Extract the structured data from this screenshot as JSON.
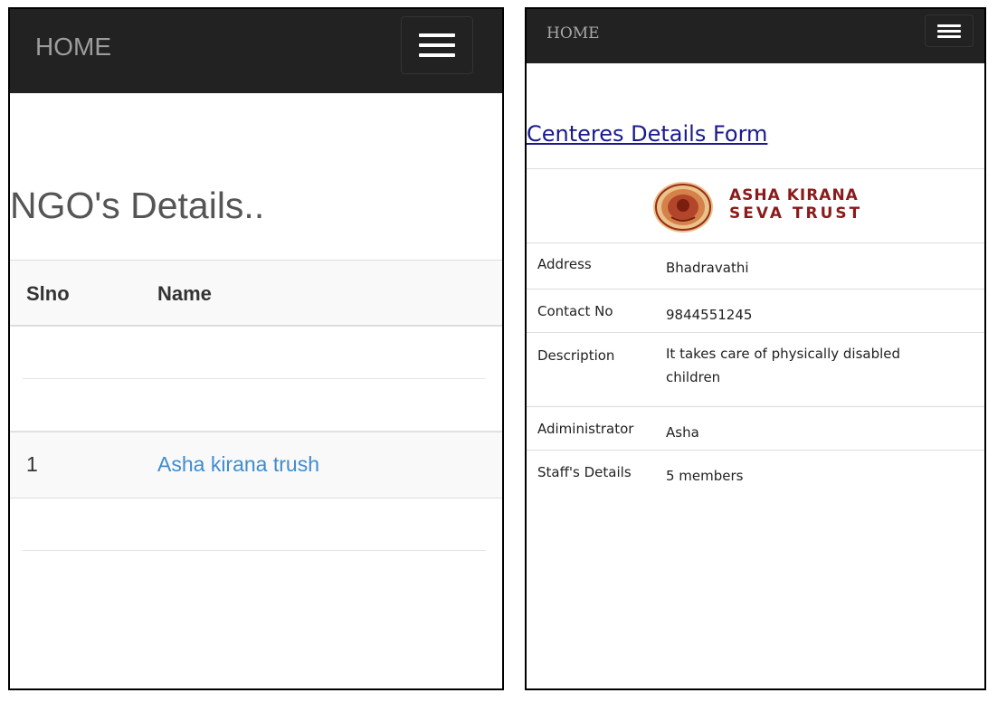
{
  "left_screen": {
    "navbar": {
      "brand": "HOME"
    },
    "page_title": "NGO's Details..",
    "table": {
      "columns": [
        "Slno",
        "Name"
      ],
      "rows": [
        {
          "slno": "1",
          "name": "Asha kirana trush"
        }
      ]
    }
  },
  "right_screen": {
    "navbar": {
      "brand": "HOME"
    },
    "form_title": "Centeres Details Form",
    "logo": {
      "line1": "ASHA KIRANA",
      "line2": "SEVA TRUST"
    },
    "details": [
      {
        "label": "Address",
        "value": "Bhadravathi"
      },
      {
        "label": "Contact No",
        "value": "9844551245"
      },
      {
        "label": "Description",
        "value": "It takes care of physically disabled children"
      },
      {
        "label": "Adiministrator",
        "value": "Asha"
      },
      {
        "label": "Staff's Details",
        "value": "5 members"
      }
    ]
  },
  "colors": {
    "navbar_bg": "#222222",
    "navbar_brand": "#9d9d9d",
    "link": "#3f8ccf",
    "form_title": "#1a1a8c",
    "logo_text": "#8b1a1a"
  }
}
